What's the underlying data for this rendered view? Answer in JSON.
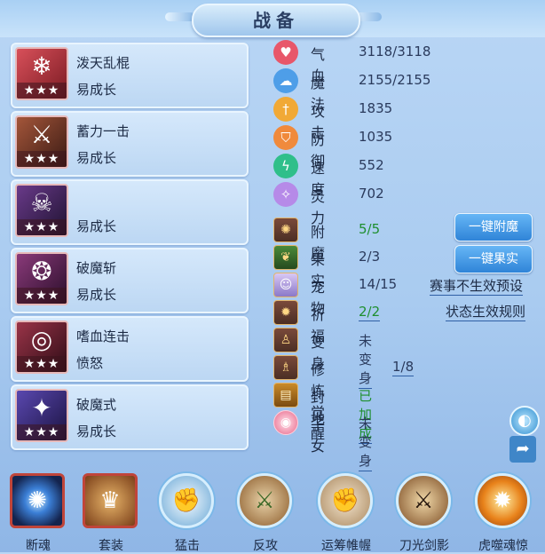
{
  "header": {
    "title": "战备"
  },
  "skills": [
    {
      "name": "泼天乱棍",
      "trait": "易成长",
      "stars": "★★★",
      "icon": "ice-staff-icon",
      "glyph": "❄",
      "color": "#b8323c"
    },
    {
      "name": "蓄力一击",
      "trait": "易成长",
      "stars": "★★★",
      "icon": "armored-warrior-icon",
      "glyph": "⚔",
      "color": "#7a3a2e"
    },
    {
      "name": "",
      "trait": "易成长",
      "stars": "★★★",
      "icon": "demon-mask-icon",
      "glyph": "☠",
      "color": "#4a2a6a"
    },
    {
      "name": "破魔斩",
      "trait": "易成长",
      "stars": "★★★",
      "icon": "golden-chain-icon",
      "glyph": "❂",
      "color": "#6a2a5a"
    },
    {
      "name": "嗜血连击",
      "trait": "愤怒",
      "stars": "★★★",
      "icon": "blood-ring-icon",
      "glyph": "◎",
      "color": "#7a2838"
    },
    {
      "name": "破魔式",
      "trait": "易成长",
      "stars": "★★★",
      "icon": "purple-warrior-icon",
      "glyph": "✦",
      "color": "#3a2a7a"
    }
  ],
  "attributes": [
    {
      "label": "气血",
      "value": "3118/3118",
      "icon": "heart-icon",
      "glyph": "♥",
      "color": "#e8576a"
    },
    {
      "label": "魔法",
      "value": "2155/2155",
      "icon": "mana-icon",
      "glyph": "☁",
      "color": "#4e9ee8"
    },
    {
      "label": "攻击",
      "value": "1835",
      "icon": "sword-icon",
      "glyph": "†",
      "color": "#f1a936"
    },
    {
      "label": "防御",
      "value": "1035",
      "icon": "shield-icon",
      "glyph": "⛉",
      "color": "#f08a3c"
    },
    {
      "label": "速度",
      "value": "552",
      "icon": "lightning-icon",
      "glyph": "ϟ",
      "color": "#2fbf8a"
    },
    {
      "label": "灵力",
      "value": "702",
      "icon": "spirit-icon",
      "glyph": "✧",
      "color": "#b68ae8"
    }
  ],
  "status": [
    {
      "label": "附魔",
      "value": "5/5",
      "icon": "enchant-icon",
      "glyph": "✺",
      "green": true,
      "underline": false
    },
    {
      "label": "果实",
      "value": "2/3",
      "icon": "fruit-icon",
      "glyph": "❦",
      "green": false,
      "underline": false
    },
    {
      "label": "宠物",
      "value": "14/15",
      "icon": "pet-icon",
      "glyph": "☺",
      "green": false,
      "underline": false
    },
    {
      "label": "祈福",
      "value": "2/2",
      "icon": "blessing-icon",
      "glyph": "✹",
      "green": true,
      "underline": true
    },
    {
      "label": "变身",
      "value": "未变身",
      "icon": "transform-icon",
      "glyph": "♙",
      "green": false,
      "underline": true
    },
    {
      "label": "修炼觉醒",
      "value": "1/8",
      "icon": "cultivation-icon",
      "glyph": "♗",
      "green": false,
      "underline": true
    },
    {
      "label": "封地",
      "value": "已加成",
      "icon": "fief-icon",
      "glyph": "▤",
      "green": true,
      "underline": true
    },
    {
      "label": "子女",
      "value": "未变身",
      "icon": "child-icon",
      "glyph": "◉",
      "green": false,
      "underline": true
    }
  ],
  "buttons": {
    "enchant": "一键附魔",
    "fruit": "一键果实"
  },
  "links": {
    "preset": "赛事不生效预设",
    "rules": "状态生效规则"
  },
  "bottom": [
    {
      "label": "断魂",
      "icon": "soul-break-icon",
      "glyph": "✺",
      "square": true,
      "color": "#1a2a55"
    },
    {
      "label": "套装",
      "icon": "gear-set-icon",
      "glyph": "♛",
      "square": true,
      "color": "#8a4a22"
    },
    {
      "label": "猛击",
      "icon": "fist-strike-icon",
      "glyph": "✊",
      "square": false,
      "color": "#8ec7e6"
    },
    {
      "label": "反攻",
      "icon": "counter-attack-icon",
      "glyph": "⚔",
      "square": false,
      "color": "#a87a4a"
    },
    {
      "label": "运筹帷幄",
      "icon": "strategy-fist-icon",
      "glyph": "✊",
      "square": false,
      "color": "#b39a78"
    },
    {
      "label": "刀光剑影",
      "icon": "blade-light-icon",
      "glyph": "⚔",
      "square": false,
      "color": "#9a6a3a"
    },
    {
      "label": "虎噬魂惊",
      "icon": "tiger-soul-icon",
      "glyph": "✹",
      "square": false,
      "color": "#e8891a"
    }
  ]
}
